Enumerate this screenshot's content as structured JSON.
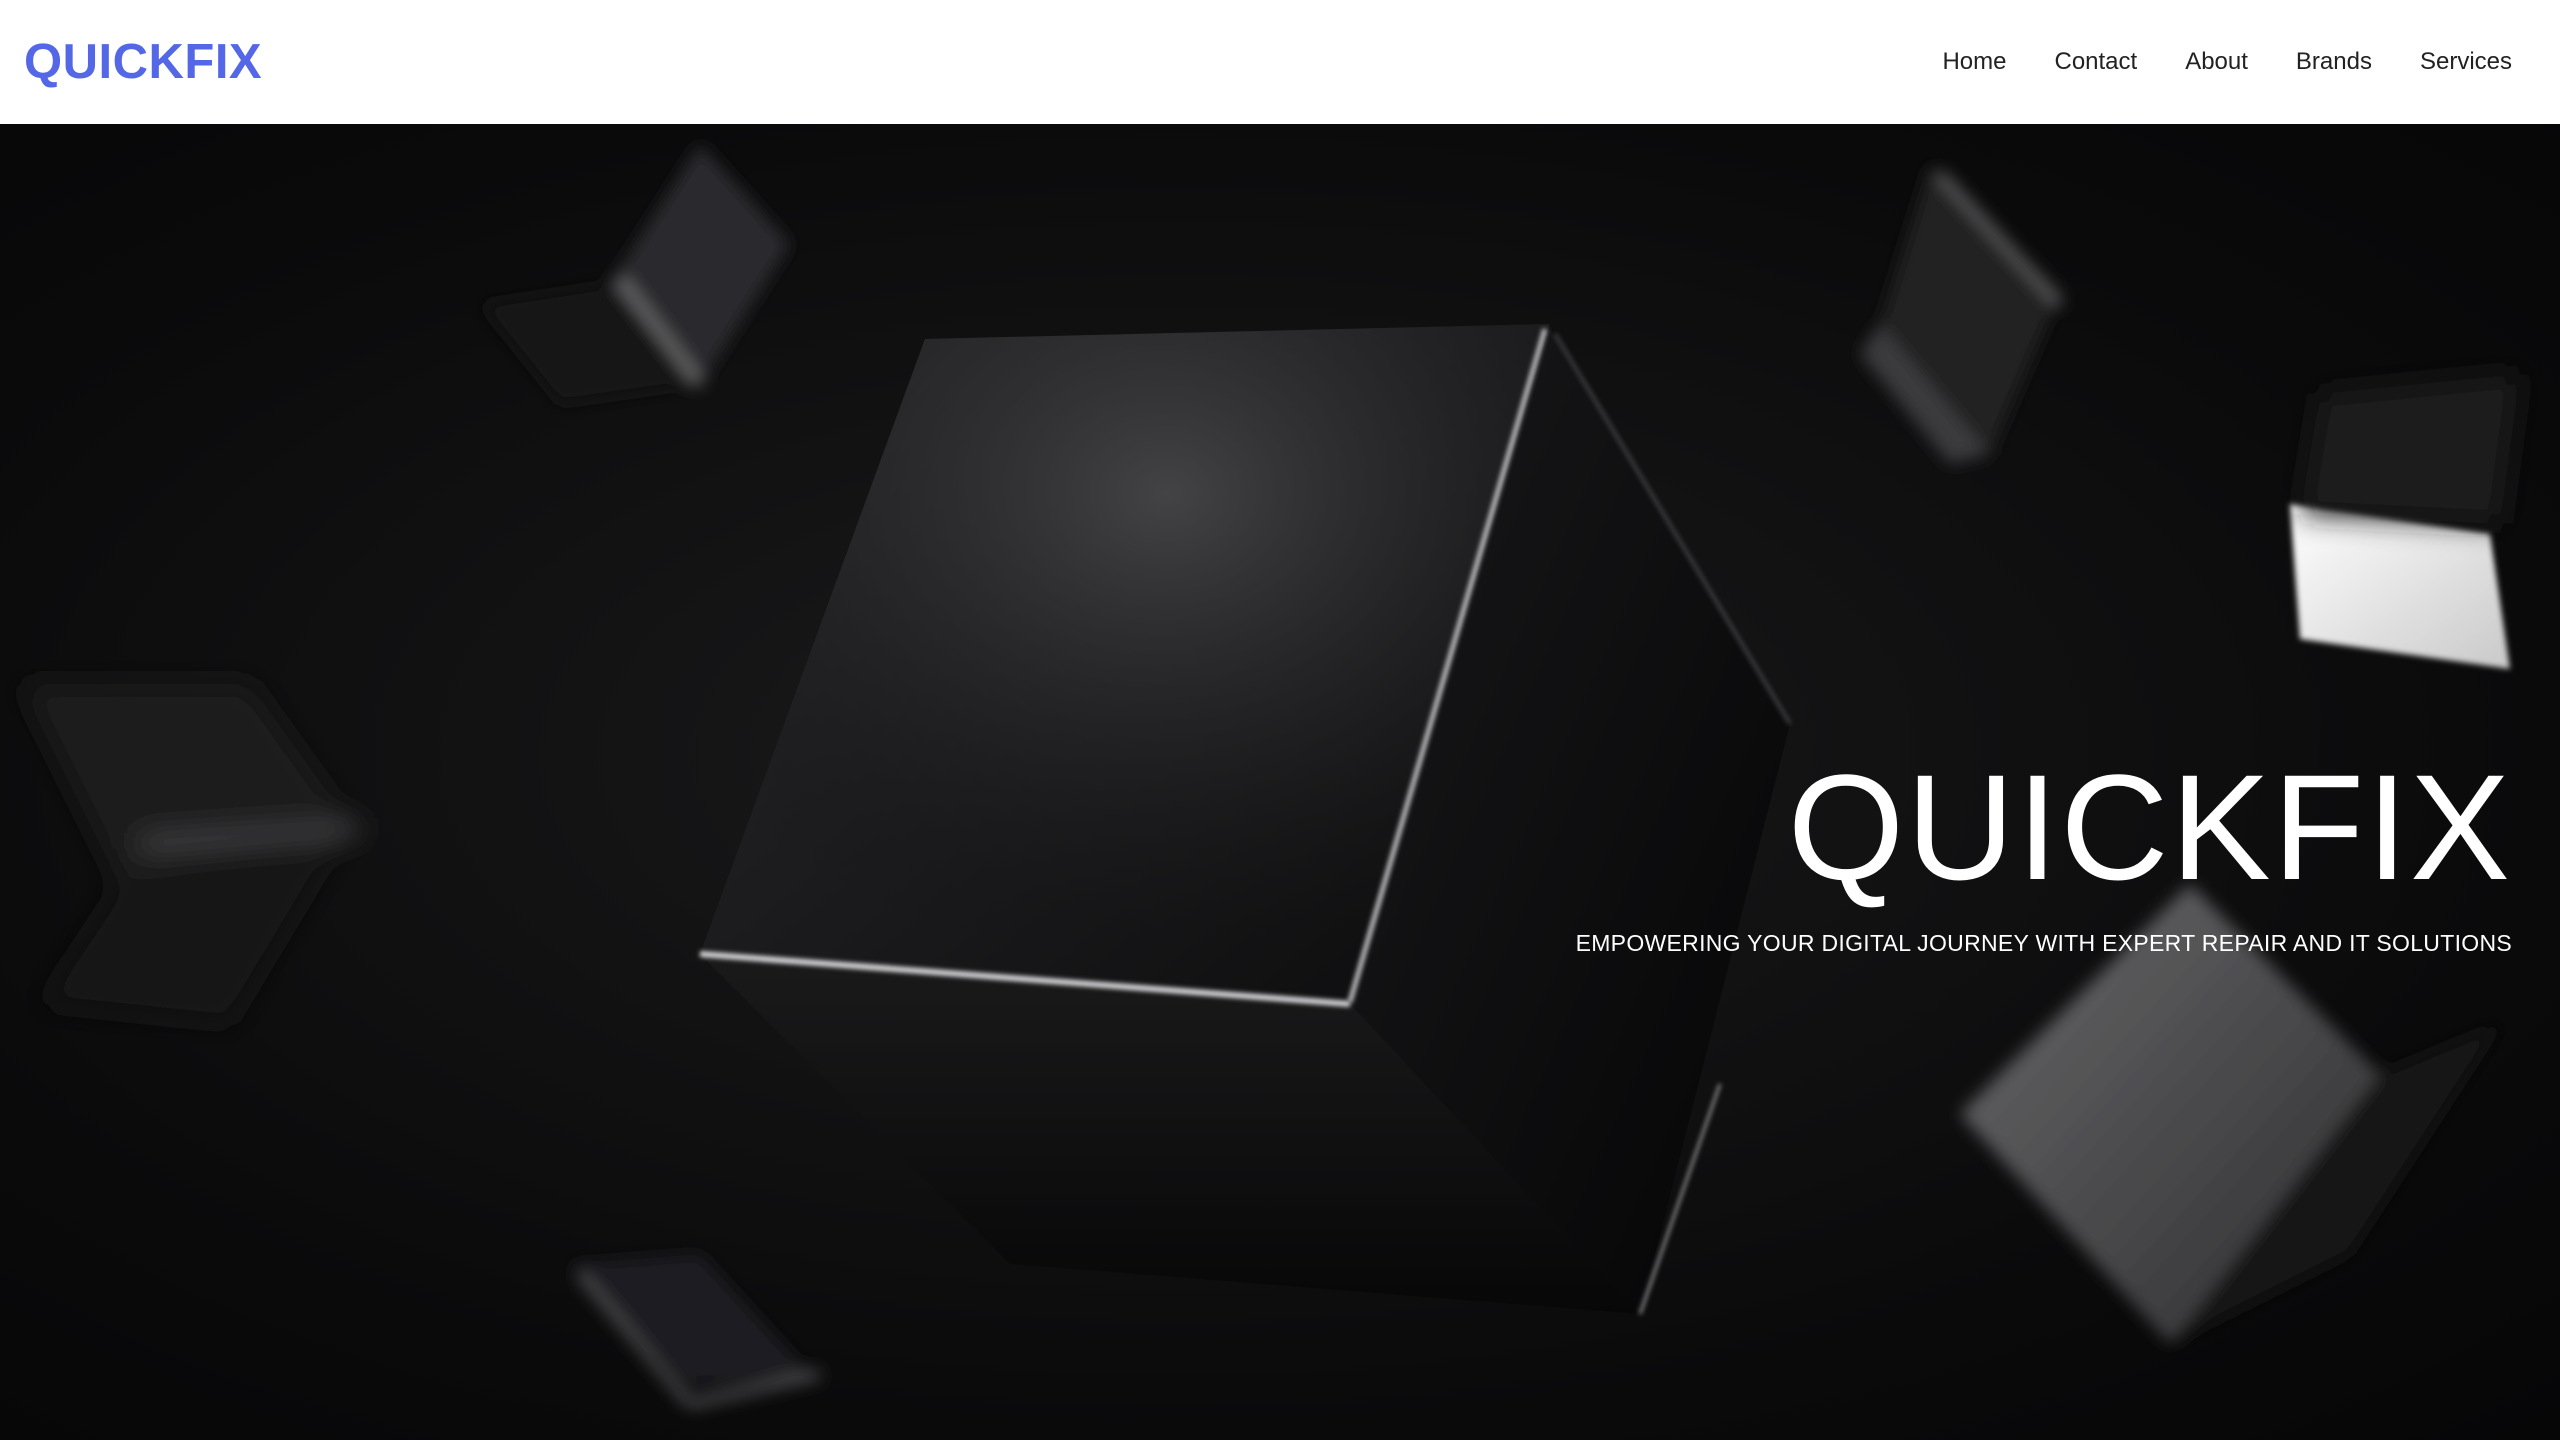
{
  "brand": {
    "name": "QUICKFIX",
    "color": "#5467e6"
  },
  "nav": {
    "items": [
      {
        "label": "Home"
      },
      {
        "label": "Contact"
      },
      {
        "label": "About"
      },
      {
        "label": "Brands"
      },
      {
        "label": "Services"
      }
    ]
  },
  "hero": {
    "title": "QUICKFIX",
    "subtitle": "EMPOWERING YOUR DIGITAL JOURNEY WITH EXPERT REPAIR AND IT SOLUTIONS",
    "background": "abstract-dark-cubes"
  }
}
